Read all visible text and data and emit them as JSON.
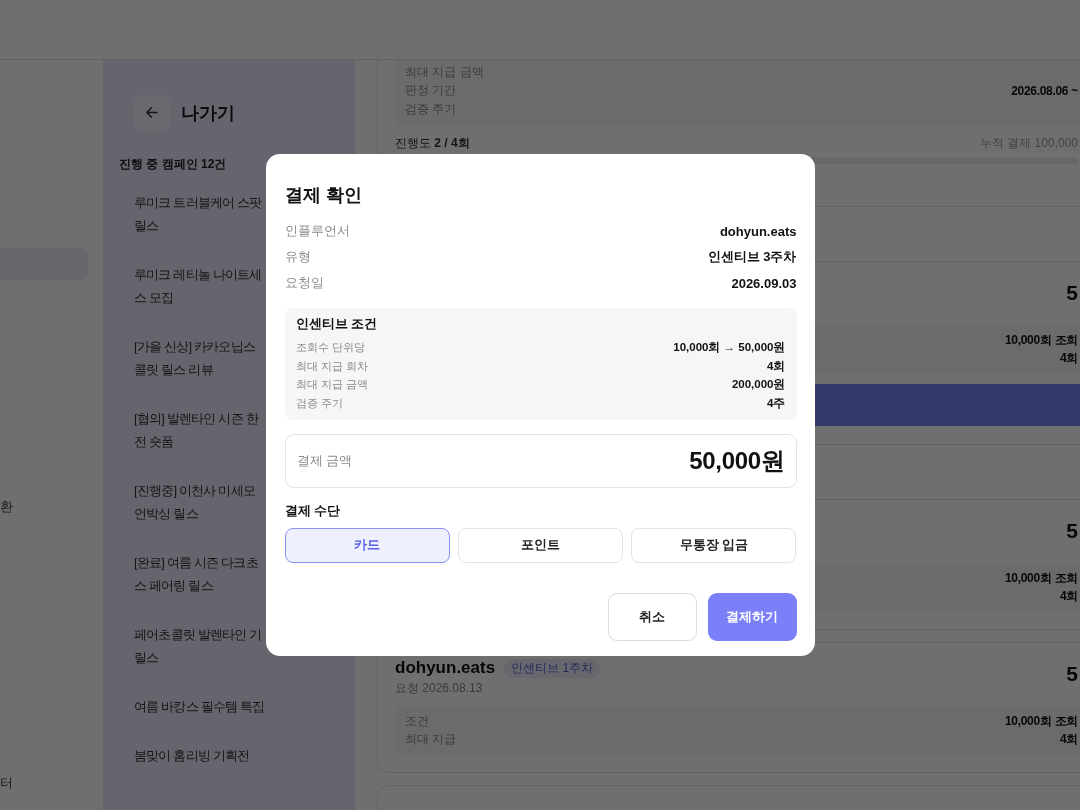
{
  "nav": {
    "items": [
      {
        "selected": true
      },
      {
        "label": "환",
        "selected": false
      },
      {
        "label": "터",
        "selected": false
      }
    ]
  },
  "campaign_panel": {
    "back_label": "나가기",
    "count": "진행 중 캠페인 12건",
    "campaigns": [
      {
        "lines": [
          "루미크 트러블케어 스팟",
          "릴스"
        ]
      },
      {
        "lines": [
          "루미크 레티놀 나이트세",
          "스 모집"
        ]
      },
      {
        "lines": [
          "[가을 신상] 카카오닙스",
          "콜릿 릴스 리뷰"
        ]
      },
      {
        "lines": [
          "[협의] 발렌타인 시즌 한",
          "전 숏폼"
        ]
      },
      {
        "lines": [
          "[진행중] 이천사 미세모",
          "언박싱 릴스"
        ]
      },
      {
        "lines": [
          "[완료] 여름 시즌 다크초",
          "스 페어링 릴스"
        ]
      },
      {
        "lines": [
          "페어초콜릿 발렌타인 기",
          "릴스"
        ]
      },
      {
        "lines": [
          "여름 바캉스 필수템 특집"
        ]
      },
      {
        "lines": [
          "봄맞이 홈리빙 기획전"
        ]
      }
    ]
  },
  "payments": {
    "sections": [
      {
        "cards": [
          {
            "kind": "continued",
            "conditions": [
              {
                "label": "최대 지급 금액"
              },
              {
                "label": "판정 기간",
                "value": "2026.08.06 ~"
              },
              {
                "label": "검증 주기"
              }
            ],
            "progress": {
              "text": "진행도 **2 / 4회**",
              "total": "누적 결제 100,000"
            }
          }
        ]
      },
      {
        "cards": [
          {
            "kind": "payment",
            "amount": "5",
            "conditions": [
              {
                "value": "10,000회 조회"
              },
              {
                "value": "4회"
              }
            ],
            "pay_button": true
          }
        ]
      },
      {
        "cards": [
          {
            "kind": "payment",
            "amount": "5",
            "conditions": [
              {
                "value": "10,000회 조회"
              },
              {
                "value": "4회"
              }
            ],
            "pay_button": false
          },
          {
            "kind": "payment",
            "name": "dohyun.eats",
            "badge": "인센티브 1주차",
            "requested": "요청 2026.08.13",
            "amount": "5",
            "conditions": [
              {
                "label": "조건",
                "value": "10,000회 조회"
              },
              {
                "label": "최대 지급",
                "value": "4회"
              }
            ],
            "pay_button": false
          },
          {
            "kind": "stub"
          }
        ]
      }
    ]
  },
  "modal": {
    "title": "결제 확인",
    "info": [
      {
        "label": "인플루언서",
        "value": "dohyun.eats"
      },
      {
        "label": "유형",
        "value": "인센티브 3주차"
      },
      {
        "label": "요청일",
        "value": "2026.09.03"
      }
    ],
    "incentive": {
      "title": "인센티브 조건",
      "rows": [
        {
          "label": "조회수 단위당",
          "value": "10,000회 → 50,000원"
        },
        {
          "label": "최대 지급 회차",
          "value": "4회"
        },
        {
          "label": "최대 지급 금액",
          "value": "200,000원"
        },
        {
          "label": "검증 주기",
          "value": "4주"
        }
      ]
    },
    "amount": {
      "label": "결제 금액",
      "value": "50,000원"
    },
    "method_title": "결제 수단",
    "methods": [
      {
        "label": "카드",
        "selected": true
      },
      {
        "label": "포인트",
        "selected": false
      },
      {
        "label": "무통장 입금",
        "selected": false
      }
    ],
    "buttons": [
      {
        "kind": "secondary",
        "label": "취소"
      },
      {
        "kind": "primary",
        "label": "결제하기"
      }
    ]
  }
}
